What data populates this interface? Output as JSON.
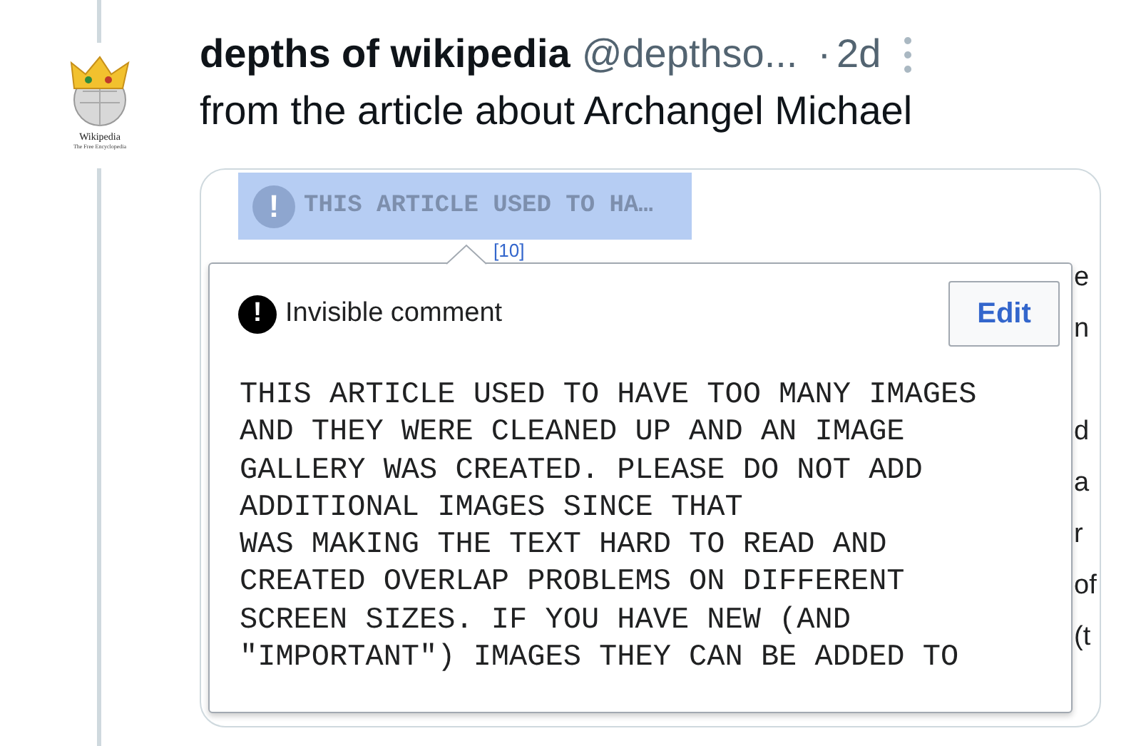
{
  "post": {
    "author": "depths of wikipedia",
    "handle": "@depthso...",
    "separator": "·",
    "time": "2d",
    "text": "from the article about Archangel Michael"
  },
  "avatar": {
    "wordmark": "Wikipedia",
    "tagline": "The Free Encyclopedia"
  },
  "screenshot": {
    "comment_marker": {
      "icon": "!",
      "label": "THIS ARTICLE USED TO HA…"
    },
    "citation": "[10]",
    "edge_fragments": [
      "e",
      "n",
      "d",
      "a",
      "r",
      "of",
      "(t"
    ],
    "popup": {
      "icon": "!",
      "title": "Invisible comment",
      "button": "Edit",
      "lines": [
        "THIS ARTICLE USED TO HAVE TOO MANY IMAGES",
        "AND THEY WERE CLEANED UP AND AN IMAGE",
        "GALLERY WAS CREATED. PLEASE DO NOT ADD",
        "ADDITIONAL IMAGES SINCE THAT",
        "WAS MAKING THE TEXT HARD TO READ AND",
        "CREATED OVERLAP PROBLEMS ON DIFFERENT",
        "SCREEN SIZES. IF YOU HAVE NEW (AND",
        "\"IMPORTANT\") IMAGES THEY CAN BE ADDED TO"
      ]
    }
  }
}
